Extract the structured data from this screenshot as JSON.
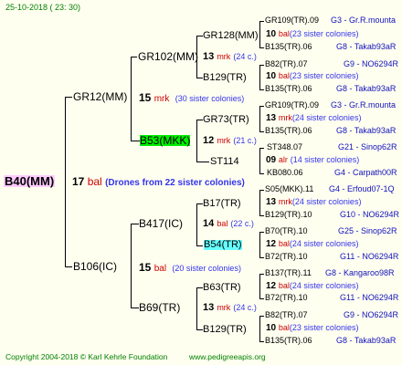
{
  "header": {
    "date": "25-10-2018 ( 23: 30)"
  },
  "root": {
    "name": "B40(MM)",
    "count": "17",
    "breeder": "bal",
    "note": "(Drones from 22 sister colonies)"
  },
  "gen1": [
    {
      "name": "GR12(MM)",
      "count": "15",
      "breeder": "mrk",
      "note": "(30 sister colonies)"
    },
    {
      "name": "B106(IC)",
      "count": "15",
      "breeder": "bal",
      "note": "(20 sister colonies)"
    }
  ],
  "gen2": [
    {
      "name": "GR102(MM)",
      "count": "13",
      "breeder": "mrk",
      "note": "(24 c.)"
    },
    {
      "name": "B53(MKK)",
      "count": "12",
      "breeder": "mrk",
      "note": "(21 c.)"
    },
    {
      "name": "B417(IC)",
      "count": "14",
      "breeder": "bal",
      "note": "(22 c.)"
    },
    {
      "name": "B69(TR)",
      "count": "13",
      "breeder": "mrk",
      "note": "(24 c.)"
    }
  ],
  "gen3": [
    {
      "name": "GR128(MM)",
      "count": "10",
      "breeder": "bal",
      "note": "(23 sister colonies)"
    },
    {
      "name": "B129(TR)",
      "count": "10",
      "breeder": "bal",
      "note": "(23 sister colonies)"
    },
    {
      "name": "GR73(TR)",
      "count": "13",
      "breeder": "mrk",
      "note": "(24 sister colonies)"
    },
    {
      "name": "ST114",
      "count": "09",
      "breeder": "alr",
      "note": "(14 sister colonies)"
    },
    {
      "name": "B17(TR)",
      "count": "13",
      "breeder": "mrk",
      "note": "(24 sister colonies)"
    },
    {
      "name": "B54(TR)",
      "count": "12",
      "breeder": "bal",
      "note": "(24 sister colonies)"
    },
    {
      "name": "B63(TR)",
      "count": "12",
      "breeder": "bal",
      "note": "(24 sister colonies)"
    },
    {
      "name": "B129(TR)",
      "count": "10",
      "breeder": "bal",
      "note": "(23 sister colonies)"
    }
  ],
  "gen4": [
    {
      "name": "GR109(TR).09",
      "location": "G3 - Gr.R.mounta"
    },
    {
      "name": "B135(TR).06",
      "location": "G8 - Takab93aR"
    },
    {
      "name": "B82(TR).07",
      "location": "G9 - NO6294R"
    },
    {
      "name": "B135(TR).06",
      "location": "G8 - Takab93aR"
    },
    {
      "name": "GR109(TR).09",
      "location": "G3 - Gr.R.mounta"
    },
    {
      "name": "B135(TR).06",
      "location": "G8 - Takab93aR"
    },
    {
      "name": "ST348.07",
      "location": "G21 - Sinop62R"
    },
    {
      "name": "KB080.06",
      "location": "G4 - Carpath00R"
    },
    {
      "name": "S05(MKK).11",
      "location": "G4 - Erfoud07-1Q"
    },
    {
      "name": "B129(TR).10",
      "location": "G10 - NO6294R"
    },
    {
      "name": "B70(TR).10",
      "location": "G25 - Sinop62R"
    },
    {
      "name": "B72(TR).10",
      "location": "G11 - NO6294R"
    },
    {
      "name": "B137(TR).11",
      "location": "G8 - Kangaroo98R"
    },
    {
      "name": "B72(TR).10",
      "location": "G11 - NO6294R"
    },
    {
      "name": "B82(TR).07",
      "location": "G9 - NO6294R"
    },
    {
      "name": "B135(TR).06",
      "location": "G8 - Takab93aR"
    }
  ],
  "footer": {
    "copyright": "Copyright 2004-2018 © Karl Kehrle Foundation",
    "website": "www.pedigreeapis.org"
  },
  "colors": {
    "background": "#fffff0",
    "root_highlight": "#ffccff",
    "green_highlight": "#00ee00",
    "cyan_highlight": "#66ffff",
    "header_green": "#008000",
    "breeder_red": "#cc0000",
    "note_blue": "#3333ee",
    "location_blue": "#1111bb"
  }
}
